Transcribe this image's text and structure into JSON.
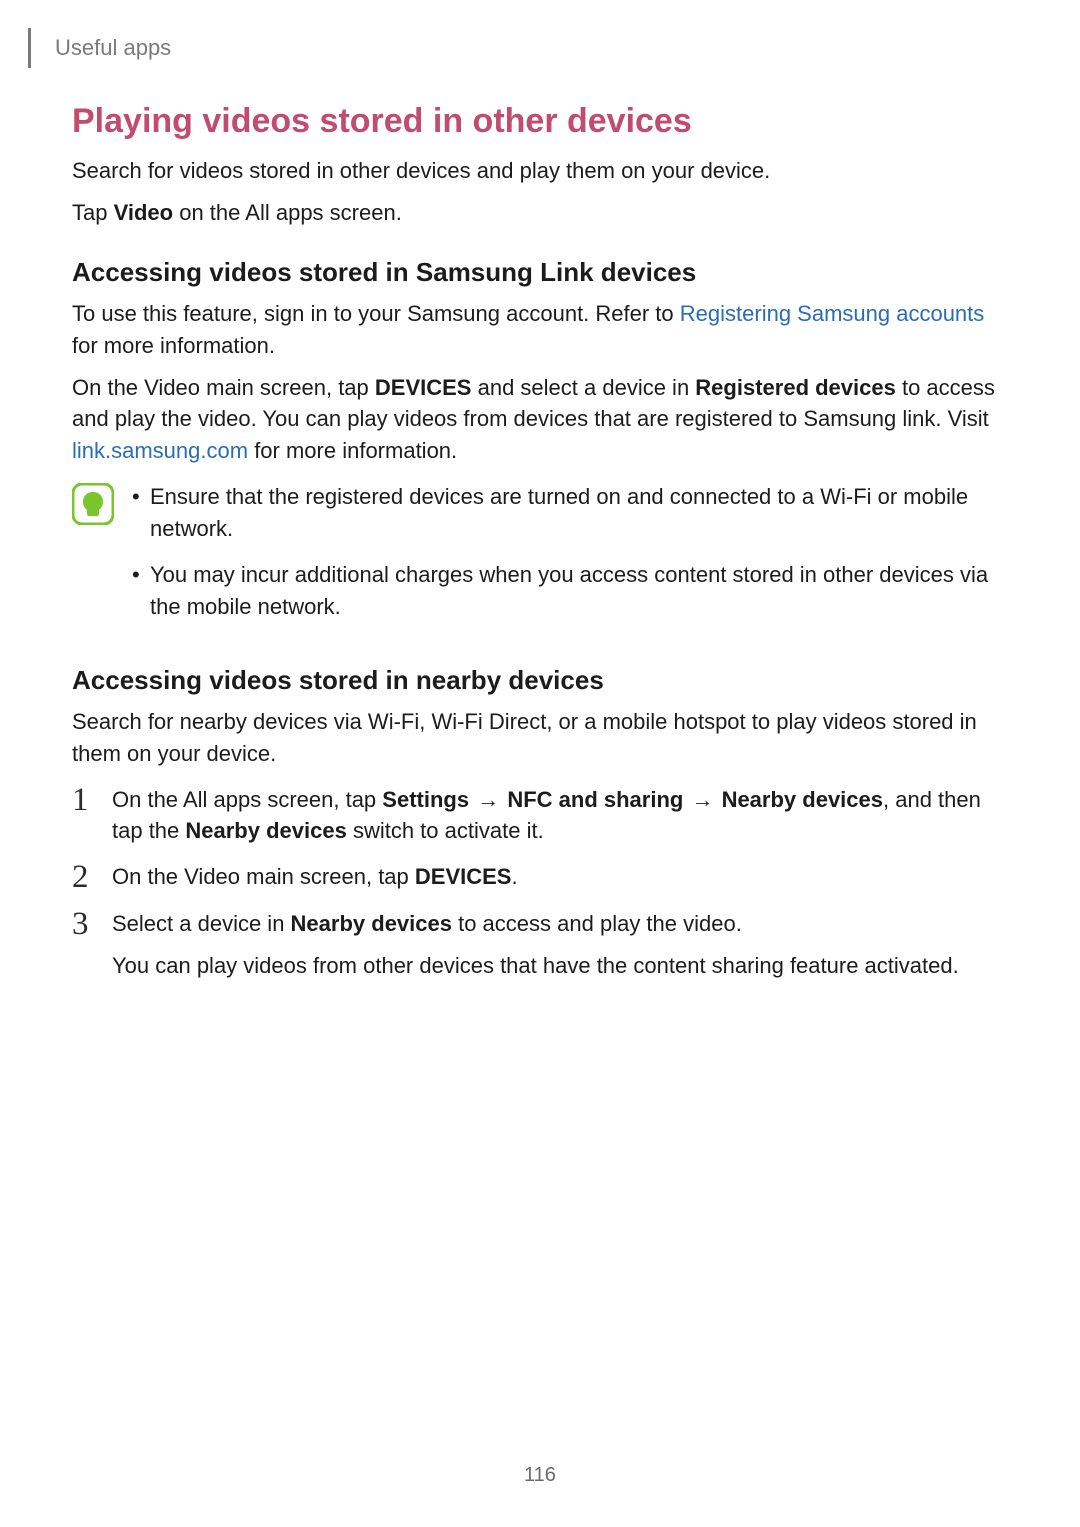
{
  "header": {
    "breadcrumb": "Useful apps"
  },
  "title": "Playing videos stored in other devices",
  "intro": {
    "line1": "Search for videos stored in other devices and play them on your device.",
    "line2_pre": "Tap ",
    "line2_bold": "Video",
    "line2_post": " on the All apps screen."
  },
  "samsung_link": {
    "heading": "Accessing videos stored in Samsung Link devices",
    "p1_pre": "To use this feature, sign in to your Samsung account. Refer to ",
    "p1_link": "Registering Samsung accounts",
    "p1_post": " for more information.",
    "p2_pre": "On the Video main screen, tap ",
    "p2_b1": "DEVICES",
    "p2_mid1": " and select a device in ",
    "p2_b2": "Registered devices",
    "p2_mid2": " to access and play the video. You can play videos from devices that are registered to Samsung link. Visit ",
    "p2_link": "link.samsung.com",
    "p2_post": " for more information."
  },
  "note": {
    "b1": "Ensure that the registered devices are turned on and connected to a Wi-Fi or mobile network.",
    "b2": "You may incur additional charges when you access content stored in other devices via the mobile network."
  },
  "nearby": {
    "heading": "Accessing videos stored in nearby devices",
    "intro": "Search for nearby devices via Wi-Fi, Wi-Fi Direct, or a mobile hotspot to play videos stored in them on your device.",
    "step1": {
      "num": "1",
      "pre": "On the All apps screen, tap ",
      "b1": "Settings",
      "arrow1": " → ",
      "b2": "NFC and sharing",
      "arrow2": " → ",
      "b3": "Nearby devices",
      "mid": ", and then tap the ",
      "b4": "Nearby devices",
      "post": " switch to activate it."
    },
    "step2": {
      "num": "2",
      "pre": "On the Video main screen, tap ",
      "b1": "DEVICES",
      "post": "."
    },
    "step3": {
      "num": "3",
      "pre": "Select a device in ",
      "b1": "Nearby devices",
      "post": " to access and play the video.",
      "sub": "You can play videos from other devices that have the content sharing feature activated."
    }
  },
  "page_number": "116"
}
